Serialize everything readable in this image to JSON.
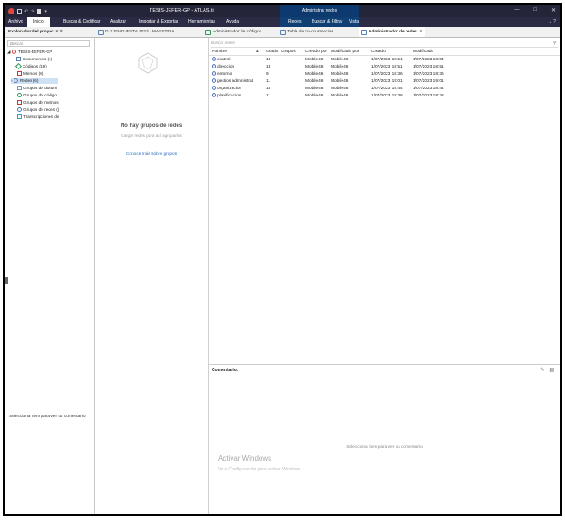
{
  "titlebar": {
    "title": "TESIS-JEFER-GP - ATLAS.ti",
    "context_tab": "Administrar redes",
    "minimize": "—",
    "maximize": "□",
    "close": "✕"
  },
  "menubar": {
    "items": [
      "Archivo",
      "Inicio",
      "Buscar & Codificar",
      "Analizar",
      "Importar & Exportar",
      "Herramientas",
      "Ayuda",
      "Redes",
      "Buscar & Filtrar",
      "Vista"
    ],
    "active": "Inicio"
  },
  "tabs": [
    {
      "label": "Explorador del proyec",
      "close": "✕"
    },
    {
      "label": "D 1: ENCUESTA 2023 - MAESTRIA"
    },
    {
      "label": "Administrador de códigos"
    },
    {
      "label": "Tabla de co-ocurrencias"
    },
    {
      "label": "Administrador de redes",
      "close": "✕"
    }
  ],
  "left": {
    "search_placeholder": "Buscar",
    "tree": [
      {
        "label": "TESIS-JEFER-GP"
      },
      {
        "label": "Documentos (1)"
      },
      {
        "label": "Códigos (19)"
      },
      {
        "label": "Memos (0)"
      },
      {
        "label": "Redes (6)"
      },
      {
        "label": "Grupos de docum"
      },
      {
        "label": "Grupos de código"
      },
      {
        "label": "Grupos de memos"
      },
      {
        "label": "Grupos de redes (("
      },
      {
        "label": "Transcripciones de"
      }
    ],
    "comment_hint": "Selecciona ítem para ver su comentario"
  },
  "middle": {
    "empty_title": "No hay grupos de redes",
    "empty_sub": "Cargar redes para así agruparlas",
    "learn_more": "Conoce más sobre grupos"
  },
  "right": {
    "search_placeholder": "Buscar redes",
    "columns": [
      "Nombre",
      "Grado",
      "Grupos",
      "Creado por",
      "Modificado por",
      "Creado",
      "Modificado"
    ],
    "rows": [
      {
        "name": "control",
        "grado": "13",
        "grupos": "",
        "creado_por": "Mobile46",
        "modificado_por": "Mobile46",
        "creado": "1/07/2023 18:54",
        "modificado": "1/07/2023 18:54"
      },
      {
        "name": "direccion",
        "grado": "13",
        "grupos": "",
        "creado_por": "Mobile46",
        "modificado_por": "Mobile46",
        "creado": "1/07/2023 18:51",
        "modificado": "1/07/2023 18:51"
      },
      {
        "name": "entorno",
        "grado": "9",
        "grupos": "",
        "creado_por": "Mobile46",
        "modificado_por": "Mobile46",
        "creado": "1/07/2023 18:36",
        "modificado": "1/07/2023 18:36"
      },
      {
        "name": "gestios administrat",
        "grado": "11",
        "grupos": "",
        "creado_por": "Mobile46",
        "modificado_por": "Mobile46",
        "creado": "1/07/2023 19:01",
        "modificado": "1/07/2023 19:01"
      },
      {
        "name": "organizacion",
        "grado": "18",
        "grupos": "",
        "creado_por": "Mobile46",
        "modificado_por": "Mobile46",
        "creado": "1/07/2023 18:44",
        "modificado": "1/07/2023 18:44"
      },
      {
        "name": "planificacion",
        "grado": "11",
        "grupos": "",
        "creado_por": "Mobile46",
        "modificado_por": "Mobile46",
        "creado": "1/07/2023 18:38",
        "modificado": "1/07/2023 18:38"
      }
    ],
    "comment_title": "Comentario:",
    "comment_empty": "Selecciona ítem para ver su comentario",
    "activate_title": "Activar Windows",
    "activate_sub": "Ve a Configuración para activar Windows."
  }
}
